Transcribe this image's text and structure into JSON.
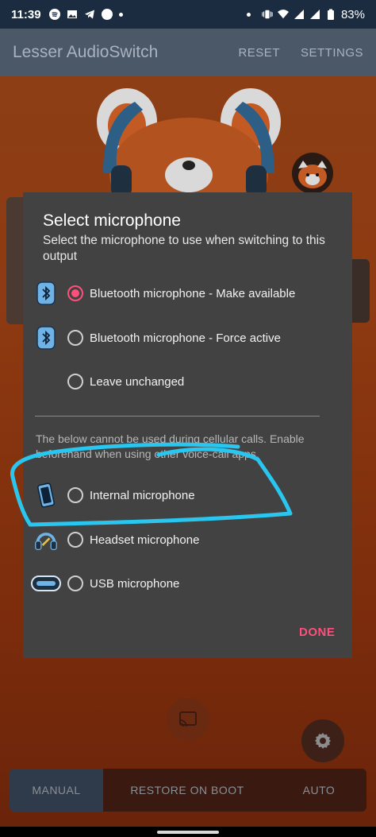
{
  "status_bar": {
    "time": "11:39",
    "battery": "83%",
    "left_icons": [
      "spotify-icon",
      "image-icon",
      "telegram-icon",
      "circle-icon",
      "dot-icon"
    ],
    "right_icons": [
      "dot-icon",
      "vibrate-icon",
      "wifi-icon",
      "signal-icon",
      "battery-icon"
    ]
  },
  "app_bar": {
    "title": "Lesser AudioSwitch",
    "actions": [
      "RESET",
      "SETTINGS"
    ]
  },
  "dialog": {
    "title": "Select microphone",
    "subtitle": "Select the microphone to use when switching to this output",
    "options": [
      {
        "label": "Bluetooth microphone - Make available",
        "icon": "bluetooth-icon",
        "selected": true
      },
      {
        "label": "Bluetooth microphone - Force active",
        "icon": "bluetooth-icon",
        "selected": false
      },
      {
        "label": "Leave unchanged",
        "icon": "",
        "selected": false
      }
    ],
    "note": "The below cannot be used during cellular calls. Enable beforehand when using other voice-call apps.",
    "call_options": [
      {
        "label": "Internal microphone",
        "icon": "phone-icon",
        "selected": false
      },
      {
        "label": "Headset microphone",
        "icon": "headset-icon",
        "selected": false
      },
      {
        "label": "USB microphone",
        "icon": "usb-c-icon",
        "selected": false
      }
    ],
    "done_label": "DONE",
    "accent_color": "#ff4f7b"
  },
  "bottom_tabs": [
    {
      "label": "MANUAL",
      "active": true
    },
    {
      "label": "RESTORE ON BOOT",
      "active": false
    },
    {
      "label": "AUTO",
      "active": false
    }
  ],
  "annotation": {
    "color": "#29c6f0",
    "shape": "hand-drawn loop around Internal microphone"
  }
}
